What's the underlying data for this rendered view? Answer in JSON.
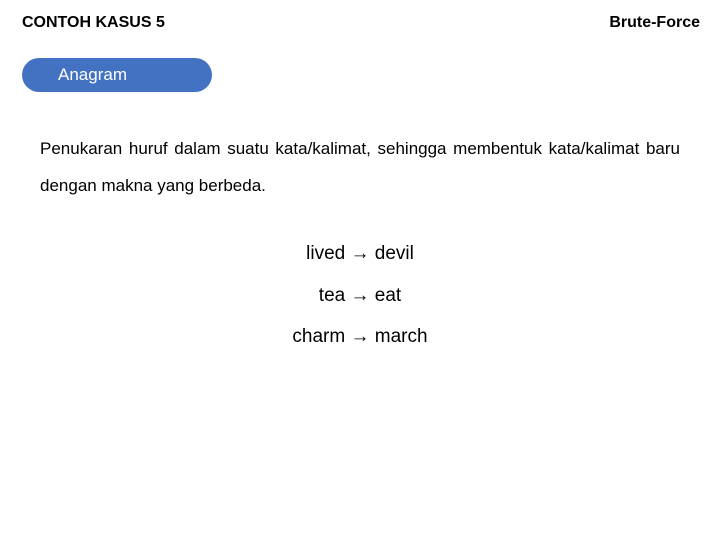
{
  "header": {
    "left": "CONTOH KASUS 5",
    "right": "Brute-Force"
  },
  "tag": {
    "label": "Anagram"
  },
  "description": "Penukaran huruf dalam suatu kata/kalimat, sehingga membentuk kata/kalimat baru dengan makna yang berbeda.",
  "arrow": "→",
  "examples": [
    {
      "from": "lived",
      "to": "devil"
    },
    {
      "from": "tea",
      "to": "eat"
    },
    {
      "from": "charm",
      "to": "march"
    }
  ]
}
